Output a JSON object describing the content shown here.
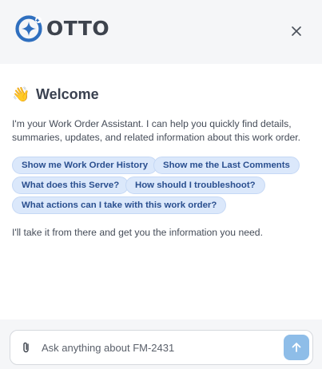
{
  "header": {
    "logo_text": "OTTO",
    "close_icon": "close-icon",
    "logo_icon": "sparkle-logo-icon"
  },
  "welcome": {
    "icon": "waving-hand-icon",
    "emoji": "👋",
    "title": "Welcome"
  },
  "intro_text": "I'm your Work Order Assistant. I can help you quickly find details, summaries, updates, and related information about this work order.",
  "suggestions": [
    "Show me Work Order History",
    "Show me the Last Comments",
    "What does this Serve?",
    "How should I troubleshoot?",
    "What actions can I take with this work order?"
  ],
  "outro_text": "I'll take it from there and get you the information you need.",
  "composer": {
    "placeholder": "Ask anything about FM-2431",
    "value": "",
    "attach_icon": "paperclip-icon",
    "send_icon": "arrow-up-icon"
  },
  "colors": {
    "brand_blue": "#2f6fbf",
    "chip_background": "#dbe8fb",
    "chip_text": "#2a4f8f",
    "send_button": "#8ebde8",
    "panel_background": "#f5f6f8"
  }
}
